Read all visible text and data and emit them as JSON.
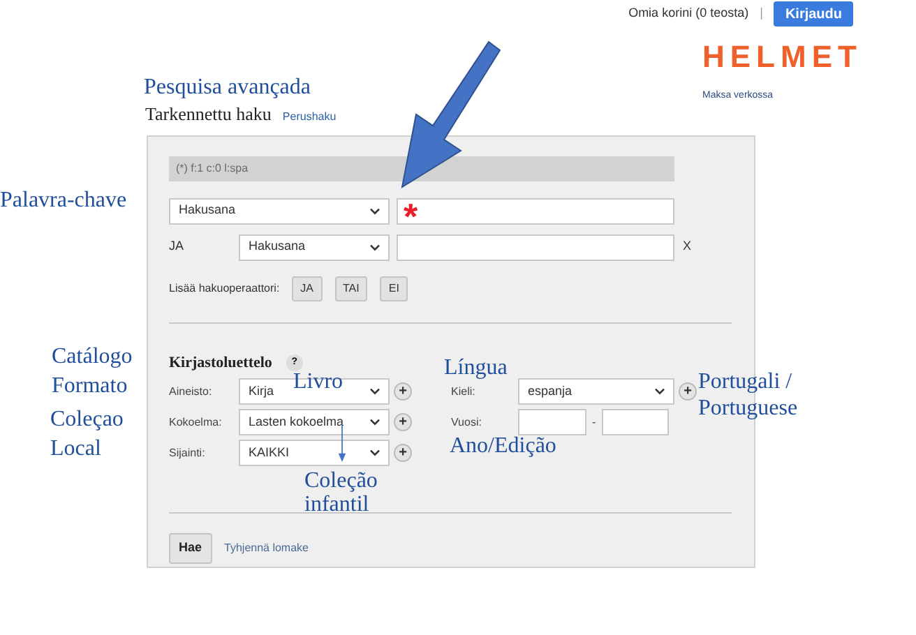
{
  "top_bar": {
    "basket": "Omia korini (0 teosta)",
    "separator": "|",
    "login_button": "Kirjaudu"
  },
  "logo": "HELMET",
  "pay_link": "Maksa verkossa",
  "heading": {
    "title": "Tarkennettu haku",
    "link": "Perushaku"
  },
  "query_bar": {
    "value": "(*) f:1 c:0 l:spa"
  },
  "search_rows": [
    {
      "operator": null,
      "field": "Hakusana",
      "value": "",
      "required_mark": "*",
      "clear": null
    },
    {
      "operator": "JA",
      "field": "Hakusana",
      "value": "",
      "required_mark": null,
      "clear": "X"
    }
  ],
  "add_operator": {
    "label": "Lisää hakuoperaattori:",
    "buttons": [
      "JA",
      "TAI",
      "EI"
    ]
  },
  "catalog": {
    "title": "Kirjastoluettelo",
    "help": "?",
    "left": [
      {
        "label": "Aineisto:",
        "value": "Kirja",
        "add": "+"
      },
      {
        "label": "Kokoelma:",
        "value": "Lasten kokoelma",
        "add": "+"
      },
      {
        "label": "Sijainti:",
        "value": "KAIKKI",
        "add": "+"
      }
    ],
    "language": {
      "label": "Kieli:",
      "value": "espanja",
      "add": "+"
    },
    "year": {
      "label": "Vuosi:",
      "dash": "-"
    }
  },
  "actions": {
    "submit": "Hae",
    "clear_link": "Tyhjennä lomake"
  },
  "annotations": [
    {
      "text": "Pesquisa avançada"
    },
    {
      "text": "Palavra-chave"
    },
    {
      "text": "Catálogo"
    },
    {
      "text": "Formato"
    },
    {
      "text": "Coleçao"
    },
    {
      "text": "Local"
    },
    {
      "text": "Livro"
    },
    {
      "text": "Língua"
    },
    {
      "text": "Portugali /"
    },
    {
      "text": "Portuguese"
    },
    {
      "text": "Ano/Edição"
    },
    {
      "text": "Coleção"
    },
    {
      "text": "infantil"
    }
  ]
}
